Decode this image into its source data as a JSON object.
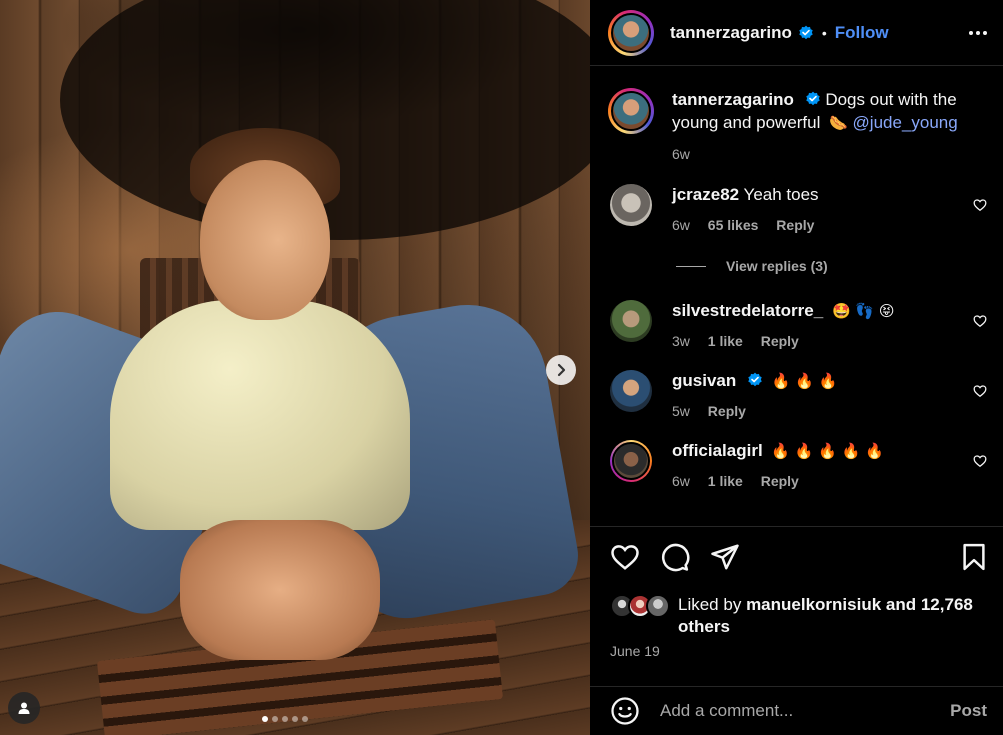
{
  "post": {
    "username": "tannerzagarino",
    "follow_label": "Follow",
    "separator": "•",
    "caption_text": "Dogs out with the young and powerful",
    "caption_emoji": "🌭",
    "caption_mention": "@jude_young",
    "caption_time": "6w"
  },
  "carousel": {
    "total": 5,
    "active": 1
  },
  "comments": [
    {
      "username": "jcraze82",
      "text": "Yeah toes",
      "time": "6w",
      "likes": "65 likes",
      "reply": "Reply",
      "view_replies": "View replies (3)"
    },
    {
      "username": "silvestredelatorre_",
      "text": "🤩 👣 😝",
      "time": "3w",
      "likes": "1 like",
      "reply": "Reply"
    },
    {
      "username": "gusivan",
      "text": "🔥 🔥 🔥",
      "time": "5w",
      "reply": "Reply"
    },
    {
      "username": "officialagirl",
      "text": "🔥 🔥 🔥 🔥 🔥",
      "time": "6w",
      "likes": "1 like",
      "reply": "Reply"
    }
  ],
  "likes": {
    "prefix": "Liked by",
    "user": "manuelkornisiuk",
    "suffix": "and 12,768 others"
  },
  "date": "June 19",
  "add_comment": {
    "placeholder": "Add a comment...",
    "post_label": "Post"
  },
  "colors": {
    "accent": "#4f8ff7",
    "mention": "#89a7f9",
    "muted": "#a8a8a8",
    "background": "#000000"
  }
}
